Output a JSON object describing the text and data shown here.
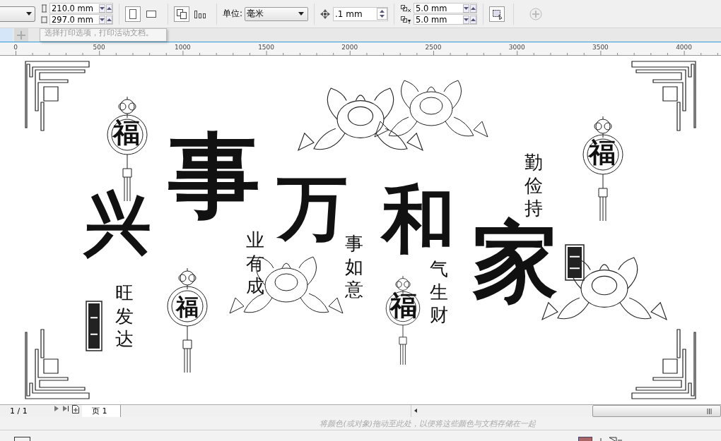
{
  "toolbar": {
    "width_field": "210.0 mm",
    "height_field": "297.0 mm",
    "orientation": [
      {
        "kind": "portrait",
        "selected": true
      },
      {
        "kind": "landscape",
        "selected": false
      }
    ],
    "unit_label": "单位:",
    "unit_dropdown": "毫米",
    "nudge_field": ".1 mm",
    "duplicate_x_field": "5.0 mm",
    "duplicate_y_field": "5.0 mm"
  },
  "tooltip": {
    "description": "选择打印选项，打印活动文档。"
  },
  "ruler": {
    "labels": [
      "0",
      "500",
      "1000",
      "1500",
      "2000",
      "2500",
      "3000",
      "3500",
      "4000"
    ]
  },
  "canvas": {
    "large_characters": [
      "兴",
      "事",
      "万",
      "和",
      "家"
    ],
    "phrases": [
      "业有成",
      "事如意",
      "气生财",
      "勤俭持",
      "旺发达"
    ],
    "knot_characters": [
      "福",
      "福",
      "福",
      "福"
    ]
  },
  "page_bar": {
    "counter": "1 / 1",
    "tabs": [
      {
        "label": "页 1",
        "selected": true
      }
    ]
  },
  "palette_hint": "将颜色(或对象)拖动至此处，以便将这些颜色与文档存储在一起"
}
